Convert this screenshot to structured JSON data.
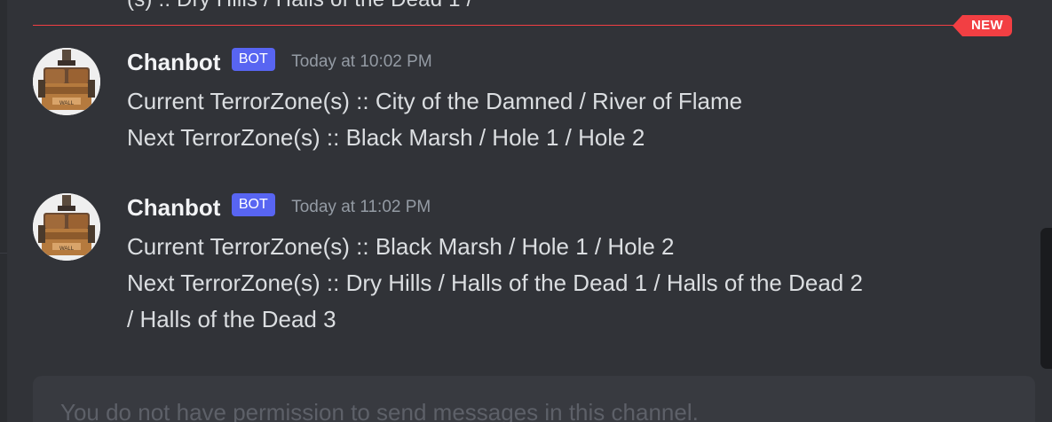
{
  "chat": {
    "previous_message_fragment": "(s) :: Dry Hills / Halls of the Dead 1 /",
    "new_divider_label": "NEW",
    "messages": [
      {
        "author": "Chanbot",
        "tag": "BOT",
        "timestamp": "Today at 10:02 PM",
        "lines": [
          "Current TerrorZone(s) :: City of the Damned / River of Flame",
          "Next TerrorZone(s) :: Black Marsh / Hole 1 / Hole 2"
        ]
      },
      {
        "author": "Chanbot",
        "tag": "BOT",
        "timestamp": "Today at 11:02 PM",
        "lines": [
          "Current TerrorZone(s) :: Black Marsh / Hole 1 / Hole 2",
          "Next TerrorZone(s) :: Dry Hills / Halls of the Dead 1 / Halls of the Dead 2",
          "/ Halls of the Dead 3"
        ]
      }
    ]
  },
  "composer": {
    "placeholder": "You do not have permission to send messages in this channel."
  },
  "colors": {
    "background": "#313338",
    "new_divider": "#f23f43",
    "bot_tag": "#5865f2",
    "message_text": "#dbdee1",
    "timestamp": "#949ba4"
  }
}
